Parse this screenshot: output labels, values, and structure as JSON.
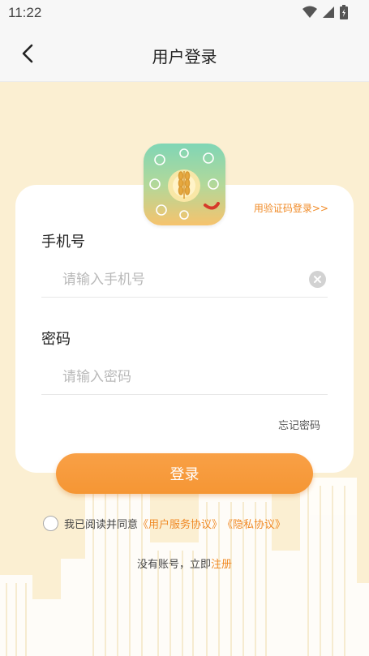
{
  "status_bar": {
    "time": "11:22",
    "icons": [
      "wifi-icon",
      "signal-icon",
      "battery-icon"
    ]
  },
  "header": {
    "title": "用户登录",
    "back_icon": "chevron-left-icon"
  },
  "login_card": {
    "code_login_link": "用验证码登录>>",
    "phone": {
      "label": "手机号",
      "placeholder": "请输入手机号",
      "value": ""
    },
    "password": {
      "label": "密码",
      "placeholder": "请输入密码",
      "value": ""
    },
    "forgot_password": "忘记密码"
  },
  "login_button": "登录",
  "agreement": {
    "checked": false,
    "prefix": "我已阅读并同意",
    "user_agreement": "《用户服务协议》",
    "privacy_policy": "《隐私协议》"
  },
  "register": {
    "prefix": "没有账号，立即",
    "link": "注册"
  },
  "colors": {
    "accent": "#f59634",
    "link": "#f08a26",
    "background": "#fbefd2",
    "card": "#ffffff"
  }
}
